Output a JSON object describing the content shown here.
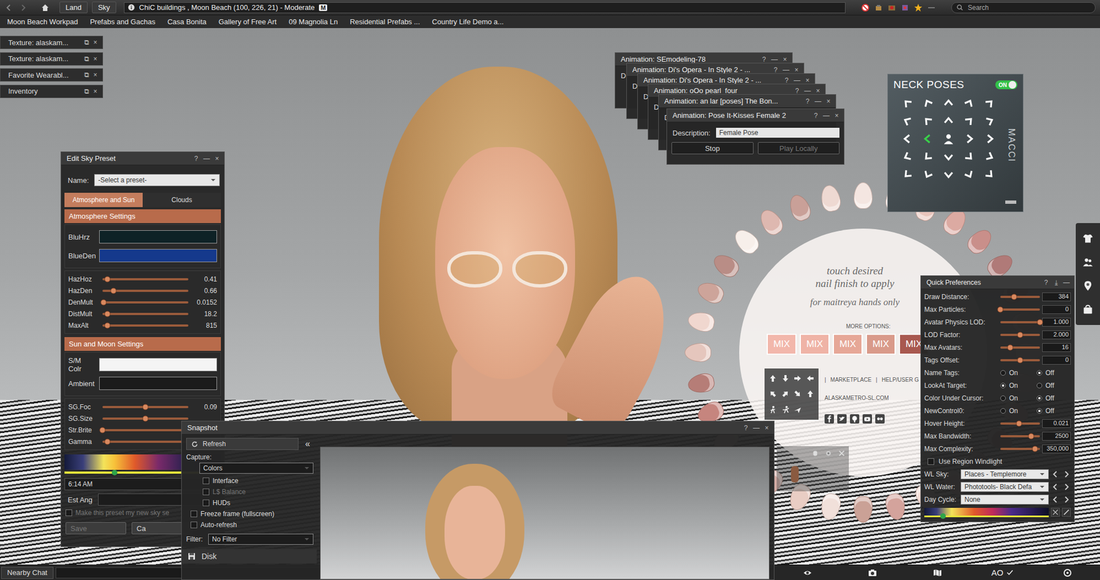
{
  "topbar": {
    "buttons": [
      "Land",
      "Sky"
    ],
    "location": "ChiC buildings , Moon Beach (100, 226, 21) - Moderate",
    "rating": "M",
    "search": {
      "placeholder": "Search"
    }
  },
  "favorites": [
    "Moon Beach Workpad",
    "Prefabs and Gachas",
    "Casa Bonita",
    "Gallery of Free Art",
    "09 Magnolia Ln",
    "Residential Prefabs ...",
    "Country Life Demo a..."
  ],
  "minimized_windows": [
    {
      "title": "Texture: alaskam...",
      "controls": [
        "⧉",
        "×"
      ]
    },
    {
      "title": "Texture: alaskam...",
      "controls": [
        "⧉",
        "×"
      ]
    },
    {
      "title": "Favorite Wearabl...",
      "controls": [
        "⧉",
        "×"
      ]
    },
    {
      "title": "Inventory",
      "controls": [
        "⧉",
        "×"
      ]
    }
  ],
  "sky_preset": {
    "title": "Edit Sky Preset",
    "controls": [
      "?",
      "—",
      "×"
    ],
    "name_label": "Name:",
    "name_value": "-Select a preset-",
    "tabs": [
      {
        "label": "Atmosphere and Sun",
        "selected": true
      },
      {
        "label": "Clouds",
        "selected": false
      }
    ],
    "sections": [
      {
        "title": "Atmosphere Settings",
        "colors": [
          {
            "label": "BluHrz",
            "color": "#0e2226"
          },
          {
            "label": "BlueDen",
            "color": "#15398c"
          }
        ],
        "sliders": [
          {
            "label": "HazHoz",
            "value": "0.41",
            "level": 0.06
          },
          {
            "label": "HazDen",
            "value": "0.66",
            "level": 0.13
          },
          {
            "label": "DenMult",
            "value": "0.0152",
            "level": 0.01
          },
          {
            "label": "DistMult",
            "value": "18.2",
            "level": 0.06
          },
          {
            "label": "MaxAlt",
            "value": "815",
            "level": 0.06
          }
        ]
      },
      {
        "title": "Sun and Moon Settings",
        "colors": [
          {
            "label": "S/M Colr",
            "color": "#f4f4f4"
          },
          {
            "label": "Ambient",
            "color": "#1b1b1b"
          }
        ],
        "sliders": [
          {
            "label": "SG.Foc",
            "value": "0.09",
            "level": 0.5
          },
          {
            "label": "SG.Size",
            "value": "",
            "level": 0.5
          },
          {
            "label": "Str.Brite",
            "value": "",
            "level": 0.0
          },
          {
            "label": "Gamma",
            "value": "",
            "level": 0.06
          }
        ]
      }
    ],
    "sun_position": {
      "level": 0.32
    },
    "time": "6:14 AM",
    "est_ang_label": "Est Ang",
    "default_checkbox": {
      "label": "Make this preset my new sky se",
      "checked": false,
      "disabled": true
    },
    "buttons": [
      {
        "label": "Save",
        "disabled": true
      },
      {
        "label": "Ca",
        "disabled": false
      }
    ]
  },
  "animation_windows": [
    {
      "title": "Animation: SEmodeling-78",
      "controls": [
        "?",
        "—",
        "×"
      ],
      "peek": "D"
    },
    {
      "title": "Animation: Di's Opera - In Style 2 - ...",
      "controls": [
        "?",
        "—",
        "×"
      ],
      "peek": "D"
    },
    {
      "title": "Animation: Di's Opera - In Style 2 - ...",
      "controls": [
        "?",
        "—",
        "×"
      ],
      "peek": "D"
    },
    {
      "title": "Animation: oOo pearl_four",
      "controls": [
        "?",
        "—",
        "×"
      ],
      "peek": "D"
    },
    {
      "title": "Animation: an lar [poses] The Bon...",
      "controls": [
        "?",
        "—",
        "×"
      ],
      "peek": "D"
    }
  ],
  "animation_front": {
    "title": "Animation: Pose It-Kisses Female 2",
    "controls": [
      "?",
      "—",
      "×"
    ],
    "description_label": "Description:",
    "description": "Female Pose",
    "buttons": [
      {
        "label": "Stop",
        "disabled": false
      },
      {
        "label": "Play Locally",
        "disabled": true
      }
    ]
  },
  "neck_poses": {
    "title": "NECK POSES",
    "toggle": {
      "label": "ON",
      "on": true
    },
    "brand": "MACCI",
    "arrows": [
      {
        "selected": false
      },
      {
        "selected": false
      },
      {
        "selected": false
      },
      {
        "selected": false
      },
      {
        "selected": false
      },
      {
        "selected": false
      },
      {
        "selected": false
      },
      {
        "selected": false
      },
      {
        "selected": false
      },
      {
        "selected": false
      },
      {
        "selected": false
      },
      {
        "selected": true
      },
      {
        "selected": false
      },
      {
        "selected": false
      },
      {
        "selected": false
      },
      {
        "selected": false
      },
      {
        "selected": false
      },
      {
        "selected": false
      },
      {
        "selected": false
      },
      {
        "selected": false
      },
      {
        "selected": false
      },
      {
        "selected": false
      },
      {
        "selected": false
      },
      {
        "selected": false
      }
    ]
  },
  "nail_hud": {
    "nails": [
      {
        "color": "#f4e6e1"
      },
      {
        "color": "#f6ece8"
      },
      {
        "color": "#e8c4bb"
      },
      {
        "color": "#dcaaa2"
      },
      {
        "color": "#c98f8a"
      },
      {
        "color": "#b07a78"
      },
      {
        "color": "#9c6868"
      },
      {
        "color": "#d9b1a8"
      },
      {
        "color": "#ecd0c8"
      },
      {
        "color": "#e2b6ad"
      },
      {
        "color": "#c99b95"
      },
      {
        "color": "#a56f6f"
      },
      {
        "color": "#8d5a5c"
      },
      {
        "color": "#e6c2ba"
      },
      {
        "color": "#f3dcd5"
      },
      {
        "color": "#d4a39c"
      },
      {
        "color": "#caa196"
      },
      {
        "color": "#f1e0da"
      },
      {
        "color": "#e9cdc4"
      },
      {
        "color": "#d5aca4"
      },
      {
        "color": "#f5ebe6"
      },
      {
        "color": "#ead0c8"
      },
      {
        "color": "#c6857e"
      },
      {
        "color": "#b67d77"
      },
      {
        "color": "#e5c6bd"
      },
      {
        "color": "#f0d7cf"
      },
      {
        "color": "#cda49a"
      },
      {
        "color": "#b98d86"
      },
      {
        "color": "#f7efea"
      },
      {
        "color": "#deb8b0"
      },
      {
        "color": "#c9a098"
      },
      {
        "color": "#eed9d2"
      }
    ],
    "caption": [
      "touch desired",
      "nail finish to apply"
    ],
    "note": "for maitreya hands only",
    "more_options": "MORE OPTIONS:",
    "mix_buttons": [
      {
        "label": "MIX",
        "color": "#f2b7ab"
      },
      {
        "label": "MIX",
        "color": "#efb3a6"
      },
      {
        "label": "MIX",
        "color": "#e6a797"
      },
      {
        "label": "MIX",
        "color": "#d99a8a"
      },
      {
        "label": "MIX",
        "color": "#a8584f"
      }
    ],
    "link_separator": "|",
    "links": [
      "MARKETPLACE",
      "HELP/USER G"
    ],
    "site": "ALASKAMETRO-SL.COM"
  },
  "snapshot": {
    "title": "Snapshot",
    "controls": [
      "?",
      "—",
      "×"
    ],
    "refresh": "Refresh",
    "collapse": "«",
    "capture_label": "Capture:",
    "capture": "Colors",
    "capture_layers": [
      {
        "label": "Interface",
        "checked": false,
        "disabled": false
      },
      {
        "label": "L$ Balance",
        "checked": false,
        "disabled": true
      },
      {
        "label": "HUDs",
        "checked": false,
        "disabled": false
      }
    ],
    "options": [
      {
        "label": "Freeze frame (fullscreen)",
        "checked": false
      },
      {
        "label": "Auto-refresh",
        "checked": false
      }
    ],
    "filter_label": "Filter:",
    "filter": "No Filter",
    "save_target": "Disk"
  },
  "quick_preferences": {
    "title": "Quick Preferences",
    "controls": [
      "?",
      "⤓",
      "—"
    ],
    "rows": [
      {
        "kind": "slider",
        "label": "Draw Distance:",
        "value": "384",
        "level": 0.35
      },
      {
        "kind": "slider",
        "label": "Max Particles:",
        "value": "0",
        "level": 0.0
      },
      {
        "kind": "slider",
        "label": "Avatar Physics LOD:",
        "value": "1.000",
        "level": 1.0
      },
      {
        "kind": "slider",
        "label": "LOD Factor:",
        "value": "2.000",
        "level": 0.5
      },
      {
        "kind": "slider",
        "label": "Max Avatars:",
        "value": "16",
        "level": 0.25
      },
      {
        "kind": "slider",
        "label": "Tags Offset:",
        "value": "0",
        "level": 0.5
      },
      {
        "kind": "radio",
        "label": "Name Tags:",
        "options": [
          {
            "label": "On",
            "selected": false
          },
          {
            "label": "Off",
            "selected": true
          }
        ]
      },
      {
        "kind": "radio",
        "label": "LookAt Target:",
        "options": [
          {
            "label": "On",
            "selected": true
          },
          {
            "label": "Off",
            "selected": false
          }
        ]
      },
      {
        "kind": "radio",
        "label": "Color Under Cursor:",
        "options": [
          {
            "label": "On",
            "selected": false
          },
          {
            "label": "Off",
            "selected": true
          }
        ]
      },
      {
        "kind": "radio",
        "label": "NewControl0:",
        "options": [
          {
            "label": "On",
            "selected": false
          },
          {
            "label": "Off",
            "selected": true
          }
        ]
      },
      {
        "kind": "slider",
        "label": "Hover Height:",
        "value": "0.021",
        "level": 0.47
      },
      {
        "kind": "slider",
        "label": "Max Bandwidth:",
        "value": "2500",
        "level": 0.78
      },
      {
        "kind": "slider",
        "label": "Max Complexity:",
        "value": "350,000",
        "level": 0.87
      },
      {
        "kind": "checkbox",
        "label": "Use Region Windlight",
        "checked": false
      },
      {
        "kind": "dropdown",
        "label": "WL Sky:",
        "value": "Places - Templemore"
      },
      {
        "kind": "dropdown",
        "label": "WL Water:",
        "value": "Phototools- Black Defa"
      },
      {
        "kind": "dropdown",
        "label": "Day Cycle:",
        "value": "None"
      },
      {
        "kind": "gradient",
        "level": 0.15
      }
    ]
  },
  "bottombar": {
    "chat_button": "Nearby Chat",
    "ao": "AO"
  }
}
